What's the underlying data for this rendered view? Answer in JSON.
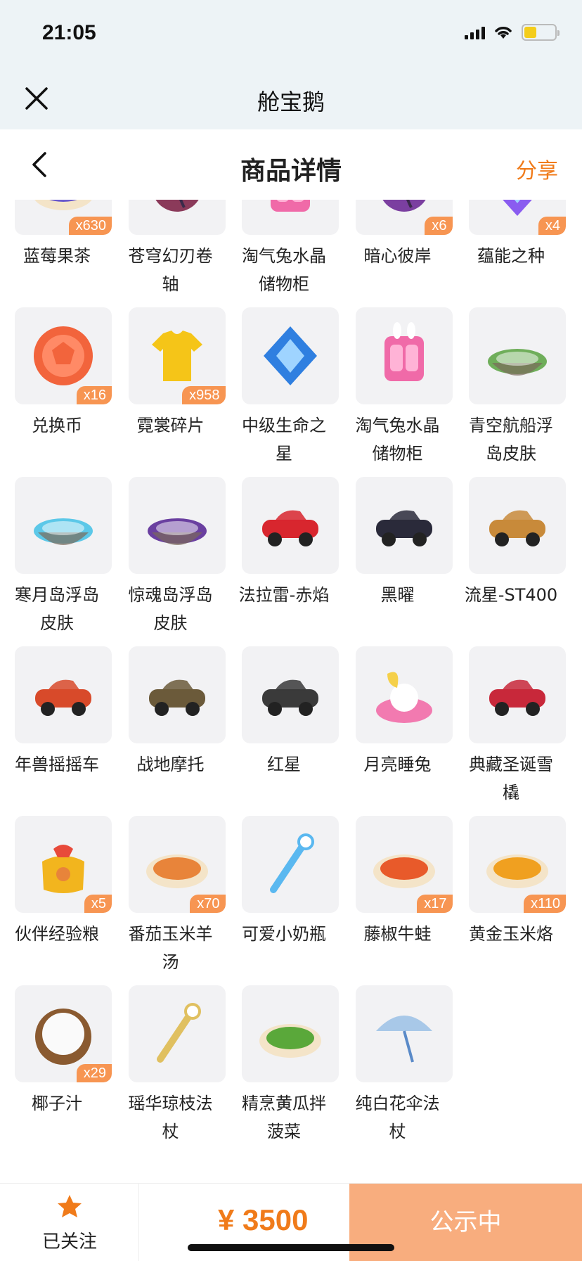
{
  "status_bar": {
    "time": "21:05"
  },
  "app": {
    "title": "舱宝鹅"
  },
  "nav": {
    "title": "商品详情",
    "share": "分享"
  },
  "items": [
    {
      "name": "蓝莓果茶",
      "count": "x630",
      "icon": "blueberry-tea-icon",
      "color": "#6a5acd"
    },
    {
      "name": "苍穹幻刃卷轴",
      "count": "",
      "icon": "scroll-icon",
      "color": "#8b3a5a"
    },
    {
      "name": "淘气兔水晶储物柜",
      "count": "",
      "icon": "cabinet-icon",
      "color": "#f06aa8"
    },
    {
      "name": "暗心彼岸",
      "count": "x6",
      "icon": "dark-flower-icon",
      "color": "#7b3fa0"
    },
    {
      "name": "蕴能之种",
      "count": "x4",
      "icon": "crystal-seed-icon",
      "color": "#8a5cf0"
    },
    {
      "name": "兑换币",
      "count": "x16",
      "icon": "coin-icon",
      "color": "#f2643c"
    },
    {
      "name": "霓裳碎片",
      "count": "x958",
      "icon": "shirt-icon",
      "color": "#f5c518"
    },
    {
      "name": "中级生命之星",
      "count": "",
      "icon": "life-star-icon",
      "color": "#2f7fe0"
    },
    {
      "name": "淘气兔水晶储物柜",
      "count": "",
      "icon": "cabinet-icon",
      "color": "#f06aa8"
    },
    {
      "name": "青空航船浮岛皮肤",
      "count": "",
      "icon": "island-skin-icon",
      "color": "#6fae5a"
    },
    {
      "name": "寒月岛浮岛皮肤",
      "count": "",
      "icon": "ice-island-icon",
      "color": "#5cc8e8"
    },
    {
      "name": "惊魂岛浮岛皮肤",
      "count": "",
      "icon": "haunted-island-icon",
      "color": "#6a3fa0"
    },
    {
      "name": "法拉雷-赤焰",
      "count": "",
      "icon": "red-car-icon",
      "color": "#d8262e"
    },
    {
      "name": "黑曜",
      "count": "",
      "icon": "black-car-icon",
      "color": "#2a2a3a"
    },
    {
      "name": "流星-ST400",
      "count": "",
      "icon": "hover-bike-icon",
      "color": "#c88a3a"
    },
    {
      "name": "年兽摇摇车",
      "count": "",
      "icon": "beast-cart-icon",
      "color": "#d84a2a"
    },
    {
      "name": "战地摩托",
      "count": "",
      "icon": "army-bike-icon",
      "color": "#6b5a3a"
    },
    {
      "name": "红星",
      "count": "",
      "icon": "motorbike-icon",
      "color": "#3a3a3a"
    },
    {
      "name": "月亮睡兔",
      "count": "",
      "icon": "moon-rabbit-icon",
      "color": "#f27ab0"
    },
    {
      "name": "典藏圣诞雪橇",
      "count": "",
      "icon": "sleigh-icon",
      "color": "#c8283a"
    },
    {
      "name": "伙伴经验粮",
      "count": "x5",
      "icon": "exp-bag-icon",
      "color": "#f2b51e"
    },
    {
      "name": "番茄玉米羊汤",
      "count": "x70",
      "icon": "soup-icon",
      "color": "#e8843a"
    },
    {
      "name": "可爱小奶瓶",
      "count": "",
      "icon": "baby-bottle-icon",
      "color": "#5ab8f0"
    },
    {
      "name": "藤椒牛蛙",
      "count": "x17",
      "icon": "dish-icon",
      "color": "#e85a2a"
    },
    {
      "name": "黄金玉米烙",
      "count": "x110",
      "icon": "corn-cake-icon",
      "color": "#f0a020"
    },
    {
      "name": "椰子汁",
      "count": "x29",
      "icon": "coconut-icon",
      "color": "#8a5a30"
    },
    {
      "name": "瑶华琼枝法杖",
      "count": "",
      "icon": "staff-icon",
      "color": "#e0c060"
    },
    {
      "name": "精烹黄瓜拌菠菜",
      "count": "",
      "icon": "salad-icon",
      "color": "#5aa83a"
    },
    {
      "name": "纯白花伞法杖",
      "count": "",
      "icon": "umbrella-staff-icon",
      "color": "#a8c8e8"
    }
  ],
  "bottom": {
    "follow_label": "已关注",
    "price": "¥ 3500",
    "status": "公示中"
  },
  "colors": {
    "accent": "#f07b1a",
    "badge": "#f79552",
    "status_button": "#f8ad7e"
  }
}
